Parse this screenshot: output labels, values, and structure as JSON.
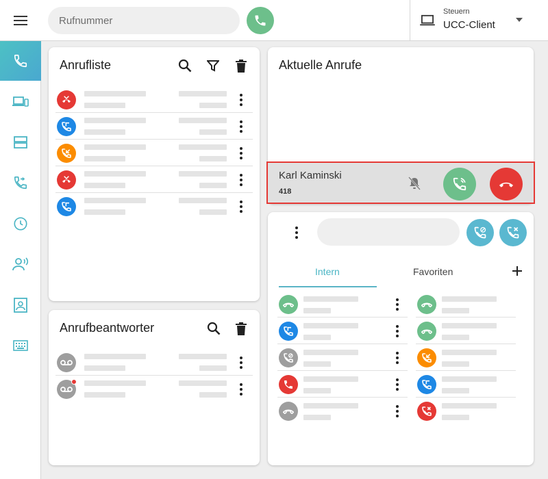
{
  "header": {
    "search_placeholder": "Rufnummer",
    "client_caption": "Steuern",
    "client_value": "UCC-Client"
  },
  "sidebar": {
    "items": [
      {
        "icon": "phone-icon",
        "active": true
      },
      {
        "icon": "devices-icon"
      },
      {
        "icon": "server-icon"
      },
      {
        "icon": "call-forward-icon"
      },
      {
        "icon": "clock-icon"
      },
      {
        "icon": "voice-icon"
      },
      {
        "icon": "contact-icon"
      },
      {
        "icon": "keyboard-icon"
      }
    ]
  },
  "call_list": {
    "title": "Anrufliste",
    "entries": [
      {
        "type": "missed",
        "color": "#e53935"
      },
      {
        "type": "outgoing",
        "color": "#1e88e5"
      },
      {
        "type": "incoming",
        "color": "#fb8c00"
      },
      {
        "type": "missed",
        "color": "#e53935"
      },
      {
        "type": "outgoing",
        "color": "#1e88e5"
      }
    ]
  },
  "voicemail": {
    "title": "Anrufbeantworter",
    "entries": [
      {
        "type": "voicemail",
        "color": "#9e9e9e",
        "unread": false
      },
      {
        "type": "voicemail",
        "color": "#9e9e9e",
        "unread": true
      }
    ]
  },
  "current_calls": {
    "title": "Aktuelle Anrufe",
    "call": {
      "name": "Karl Kaminski",
      "number": "418"
    }
  },
  "contacts": {
    "tabs": [
      {
        "label": "Intern",
        "active": true
      },
      {
        "label": "Favoriten"
      }
    ],
    "intern": [
      {
        "type": "idle",
        "color": "#6dbf8b"
      },
      {
        "type": "outgoing",
        "color": "#1e88e5"
      },
      {
        "type": "forward",
        "color": "#9e9e9e"
      },
      {
        "type": "busy",
        "color": "#e53935"
      },
      {
        "type": "offline",
        "color": "#9e9e9e"
      }
    ],
    "favorites": [
      {
        "type": "idle",
        "color": "#6dbf8b"
      },
      {
        "type": "idle",
        "color": "#6dbf8b"
      },
      {
        "type": "incoming",
        "color": "#fb8c00"
      },
      {
        "type": "outgoing",
        "color": "#1e88e5"
      },
      {
        "type": "missed",
        "color": "#e53935"
      }
    ]
  },
  "colors": {
    "accent": "#4ab5c4",
    "green": "#6dbf8b",
    "red": "#e53935"
  }
}
